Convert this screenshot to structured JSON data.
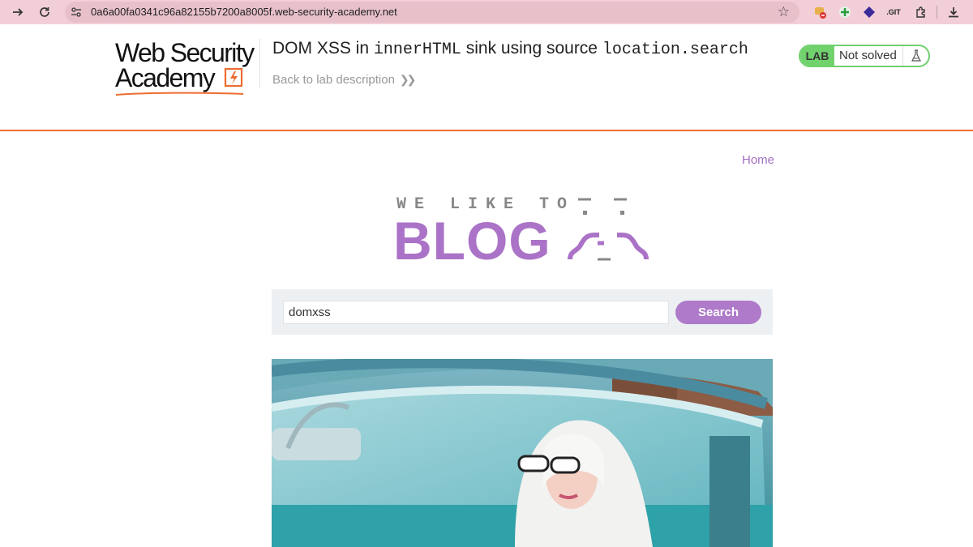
{
  "browser": {
    "url": "0a6a00fa0341c96a82155b7200a8005f.web-security-academy.net",
    "extensions": [
      ".GIT"
    ]
  },
  "header": {
    "logo_line1": "Web Security",
    "logo_line2": "Academy",
    "lab_title_prefix": "DOM XSS in ",
    "lab_title_code1": "innerHTML",
    "lab_title_middle": " sink using source ",
    "lab_title_code2": "location.search",
    "back_link": "Back to lab description",
    "lab_badge": "LAB",
    "lab_status": "Not solved"
  },
  "blog": {
    "home_link": "Home",
    "tagline": "WE LIKE TO",
    "title": "BLOG",
    "search_value": "domxss",
    "search_button": "Search"
  },
  "colors": {
    "chrome_bar": "#f2cfd8",
    "accent_orange": "#ee6c30",
    "lab_green": "#70d16d",
    "blog_purple": "#ab73c7"
  }
}
